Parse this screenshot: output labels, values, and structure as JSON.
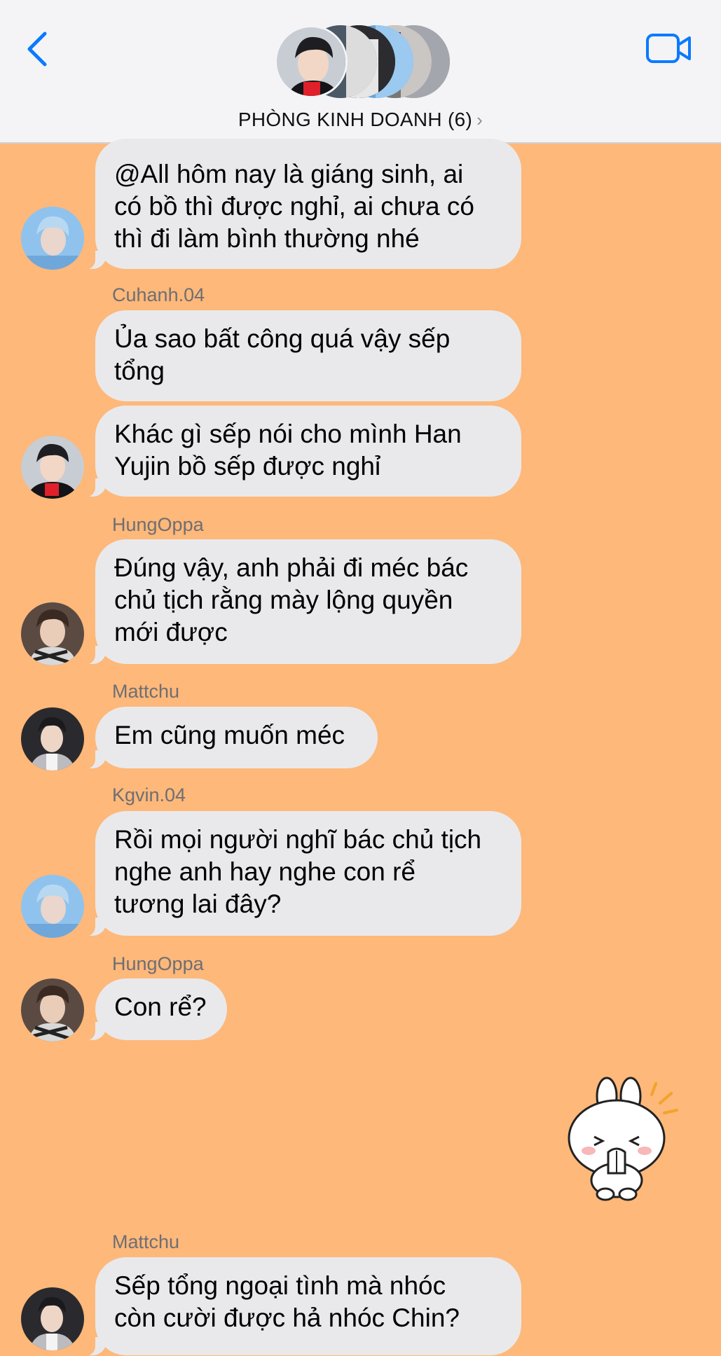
{
  "header": {
    "back_icon": "chevron-left-icon",
    "video_icon": "video-camera-icon",
    "group_name": "PHÒNG KINH DOANH (6)",
    "chevron": "›",
    "accent_color": "#0A7AFF"
  },
  "chat": {
    "background_color": "#FDB87A",
    "bubble_color": "#E9E9EB",
    "messages": [
      {
        "sender": "",
        "lines": [
          "@All hôm nay là giáng sinh, ai",
          "có bồ thì được nghỉ, ai chưa có",
          "thì đi làm bình thường nhé"
        ]
      },
      {
        "sender": "Cuhanh.04",
        "lines": [
          "Ủa sao bất công quá vậy sếp",
          "tổng"
        ]
      },
      {
        "sender": "",
        "lines": [
          "Khác gì sếp nói cho mình Han",
          "Yujin bồ sếp được nghỉ"
        ]
      },
      {
        "sender": "HungOppa",
        "lines": [
          "Đúng vậy, anh phải đi méc bác",
          "chủ tịch rằng mày lộng quyền",
          "mới được"
        ]
      },
      {
        "sender": "Mattchu",
        "lines": [
          "Em cũng muốn méc"
        ]
      },
      {
        "sender": "Kgvin.04",
        "lines": [
          "Rồi mọi người nghĩ bác chủ tịch",
          "nghe anh hay nghe con rể",
          "tương lai đây?"
        ]
      },
      {
        "sender": "HungOppa",
        "lines": [
          "Con rể?"
        ]
      },
      {
        "sender": "Mattchu",
        "lines": [
          "Sếp tổng ngoại tình mà nhóc",
          "còn cười được hả nhóc Chin?"
        ]
      }
    ],
    "sticker": "bunny-shy-sticker"
  }
}
